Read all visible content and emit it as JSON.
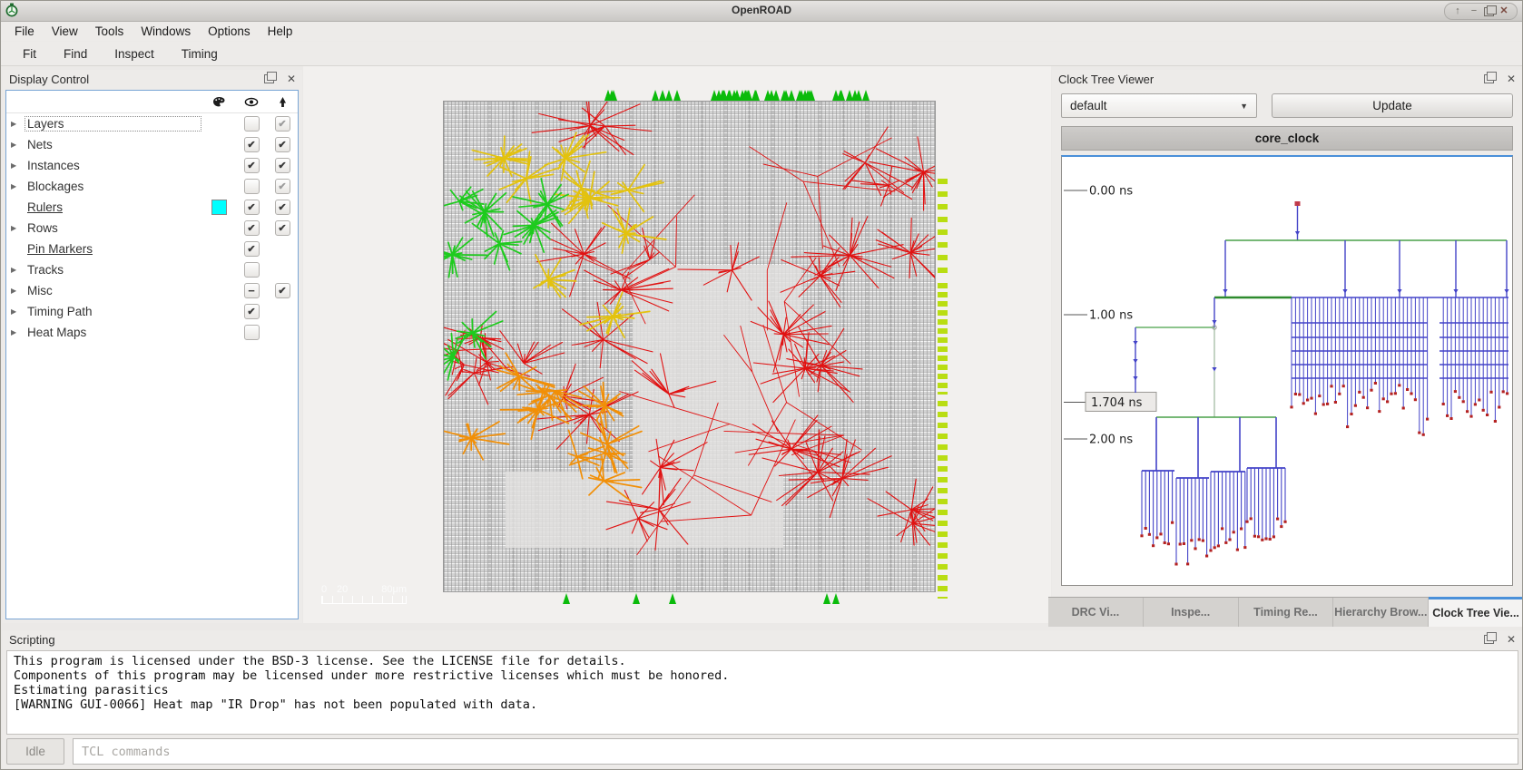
{
  "window": {
    "title": "OpenROAD",
    "control_icons": [
      "shade",
      "minimize",
      "maximize",
      "close"
    ]
  },
  "menu_bar": {
    "items": [
      "File",
      "View",
      "Tools",
      "Windows",
      "Options",
      "Help"
    ]
  },
  "toolbar": {
    "items": [
      "Fit",
      "Find",
      "Inspect",
      "Timing"
    ]
  },
  "display_control": {
    "title": "Display Control",
    "column_icons": [
      "palette",
      "eye",
      "selectable"
    ],
    "rows": [
      {
        "label": "Layers",
        "expandable": true,
        "underline": false,
        "current": true,
        "swatch": null,
        "visible": "unchecked",
        "selectable": "checked-disabled"
      },
      {
        "label": "Nets",
        "expandable": true,
        "underline": false,
        "current": false,
        "swatch": null,
        "visible": "checked",
        "selectable": "checked"
      },
      {
        "label": "Instances",
        "expandable": true,
        "underline": false,
        "current": false,
        "swatch": null,
        "visible": "checked",
        "selectable": "checked"
      },
      {
        "label": "Blockages",
        "expandable": true,
        "underline": false,
        "current": false,
        "swatch": null,
        "visible": "unchecked",
        "selectable": "checked-disabled"
      },
      {
        "label": "Rulers",
        "expandable": false,
        "underline": true,
        "current": false,
        "swatch": "#00ffff",
        "visible": "checked",
        "selectable": "checked"
      },
      {
        "label": "Rows",
        "expandable": true,
        "underline": false,
        "current": false,
        "swatch": null,
        "visible": "checked",
        "selectable": "checked"
      },
      {
        "label": "Pin Markers",
        "expandable": false,
        "underline": true,
        "current": false,
        "swatch": null,
        "visible": "checked",
        "selectable": null
      },
      {
        "label": "Tracks",
        "expandable": true,
        "underline": false,
        "current": false,
        "swatch": null,
        "visible": "unchecked",
        "selectable": null
      },
      {
        "label": "Misc",
        "expandable": true,
        "underline": false,
        "current": false,
        "swatch": null,
        "visible": "partial",
        "selectable": "checked"
      },
      {
        "label": "Timing Path",
        "expandable": true,
        "underline": false,
        "current": false,
        "swatch": null,
        "visible": "checked",
        "selectable": null
      },
      {
        "label": "Heat Maps",
        "expandable": true,
        "underline": false,
        "current": false,
        "swatch": null,
        "visible": "unchecked",
        "selectable": null
      }
    ]
  },
  "layout_viewer": {
    "ruler": {
      "labels": [
        "0",
        "20",
        "80μm"
      ]
    },
    "colors": {
      "red_nets": "#e01212",
      "yellow_nets": "#e3c20e",
      "green_nets": "#1ecb1e",
      "orange_nets": "#f18f07",
      "pin_markers_top": "#0bbb0b",
      "pin_markers_right": "#b9dd12"
    }
  },
  "clock_tree_viewer": {
    "title": "Clock Tree Viewer",
    "clock_select": "default",
    "update_label": "Update",
    "tree_title": "core_clock",
    "times": [
      {
        "t": 0,
        "label": "0.00 ns",
        "boxed": false
      },
      {
        "t": 1,
        "label": "1.00 ns",
        "boxed": false
      },
      {
        "t": 1.704,
        "label": "1.704 ns",
        "boxed": true
      },
      {
        "t": 2,
        "label": "2.00 ns",
        "boxed": false
      }
    ],
    "colors": {
      "trunk_green": "#2e8b2e",
      "branch_blue": "#4343c8",
      "leaf_red": "#b42222"
    }
  },
  "bottom_tabs": [
    {
      "label": "DRC Vi...",
      "active": false
    },
    {
      "label": "Inspe...",
      "active": false
    },
    {
      "label": "Timing Re...",
      "active": false
    },
    {
      "label": "Hierarchy Brow...",
      "active": false
    },
    {
      "label": "Clock Tree Vie...",
      "active": true
    }
  ],
  "scripting": {
    "title": "Scripting",
    "log_lines": [
      "This program is licensed under the BSD-3 license. See the LICENSE file for details.",
      "Components of this program may be licensed under more restrictive licenses which must be honored.",
      "Estimating parasitics",
      "[WARNING GUI-0066] Heat map \"IR Drop\" has not been populated with data."
    ],
    "status_label": "Idle",
    "input_placeholder": "TCL commands"
  }
}
